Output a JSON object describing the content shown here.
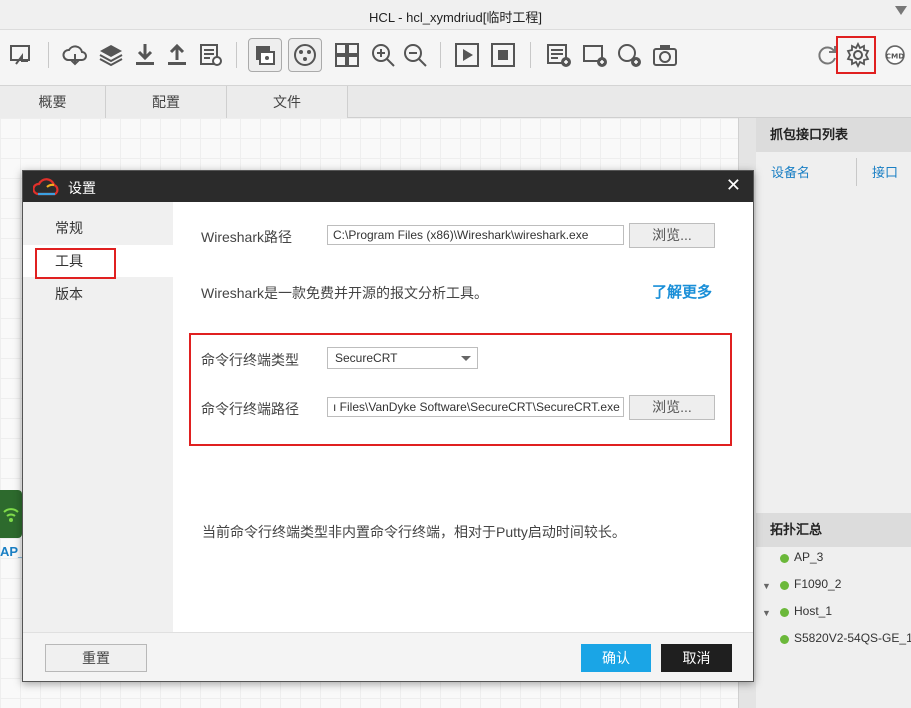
{
  "window": {
    "title": "HCL - hcl_xymdriud[临时工程]"
  },
  "toolbar": {
    "icons": [
      "import-icon",
      "cloud-download-icon",
      "layers-icon",
      "download-icon",
      "upload-icon",
      "report-icon",
      "screenshot-view-icon",
      "topology-view-icon",
      "grid-icon",
      "zoom-in-icon",
      "zoom-out-icon",
      "play-icon",
      "stop-icon",
      "add-text-icon",
      "add-rect-icon",
      "add-ellipse-icon",
      "camera-icon",
      "refresh-icon",
      "gear-icon",
      "cmd-icon"
    ],
    "cmd_label": "CMD"
  },
  "tabs": [
    {
      "label": "概要"
    },
    {
      "label": "配置"
    },
    {
      "label": "文件"
    }
  ],
  "right_panel": {
    "capture_title": "抓包接口列表",
    "col_device": "设备名",
    "col_interface": "接口",
    "topology_title": "拓扑汇总",
    "topology_items": [
      {
        "label": "AP_3",
        "has_arrow": false
      },
      {
        "label": "F1090_2",
        "has_arrow": true
      },
      {
        "label": "Host_1",
        "has_arrow": true
      },
      {
        "label": "S5820V2-54QS-GE_1",
        "has_arrow": false
      }
    ]
  },
  "canvas": {
    "device_label": "AP_"
  },
  "dialog": {
    "title": "设置",
    "nav": [
      {
        "label": "常规"
      },
      {
        "label": "工具"
      },
      {
        "label": "版本"
      }
    ],
    "active_nav": "工具",
    "wireshark_label": "Wireshark路径",
    "wireshark_path": "C:\\Program Files (x86)\\Wireshark\\wireshark.exe",
    "browse_label": "浏览...",
    "wireshark_info": "Wireshark是一款免费并开源的报文分析工具。",
    "learn_more": "了解更多",
    "terminal_type_label": "命令行终端类型",
    "terminal_type_value": "SecureCRT",
    "terminal_path_label": "命令行终端路径",
    "terminal_path": "ı Files\\VanDyke Software\\SecureCRT\\SecureCRT.exe",
    "terminal_note": "当前命令行终端类型非内置命令行终端，相对于Putty启动时间较长。",
    "reset_label": "重置",
    "ok_label": "确认",
    "cancel_label": "取消"
  },
  "colors": {
    "accent": "#1aa5e6",
    "highlight": "#e02020",
    "link": "#1a8fd8",
    "status_dot": "#6bb83a"
  }
}
